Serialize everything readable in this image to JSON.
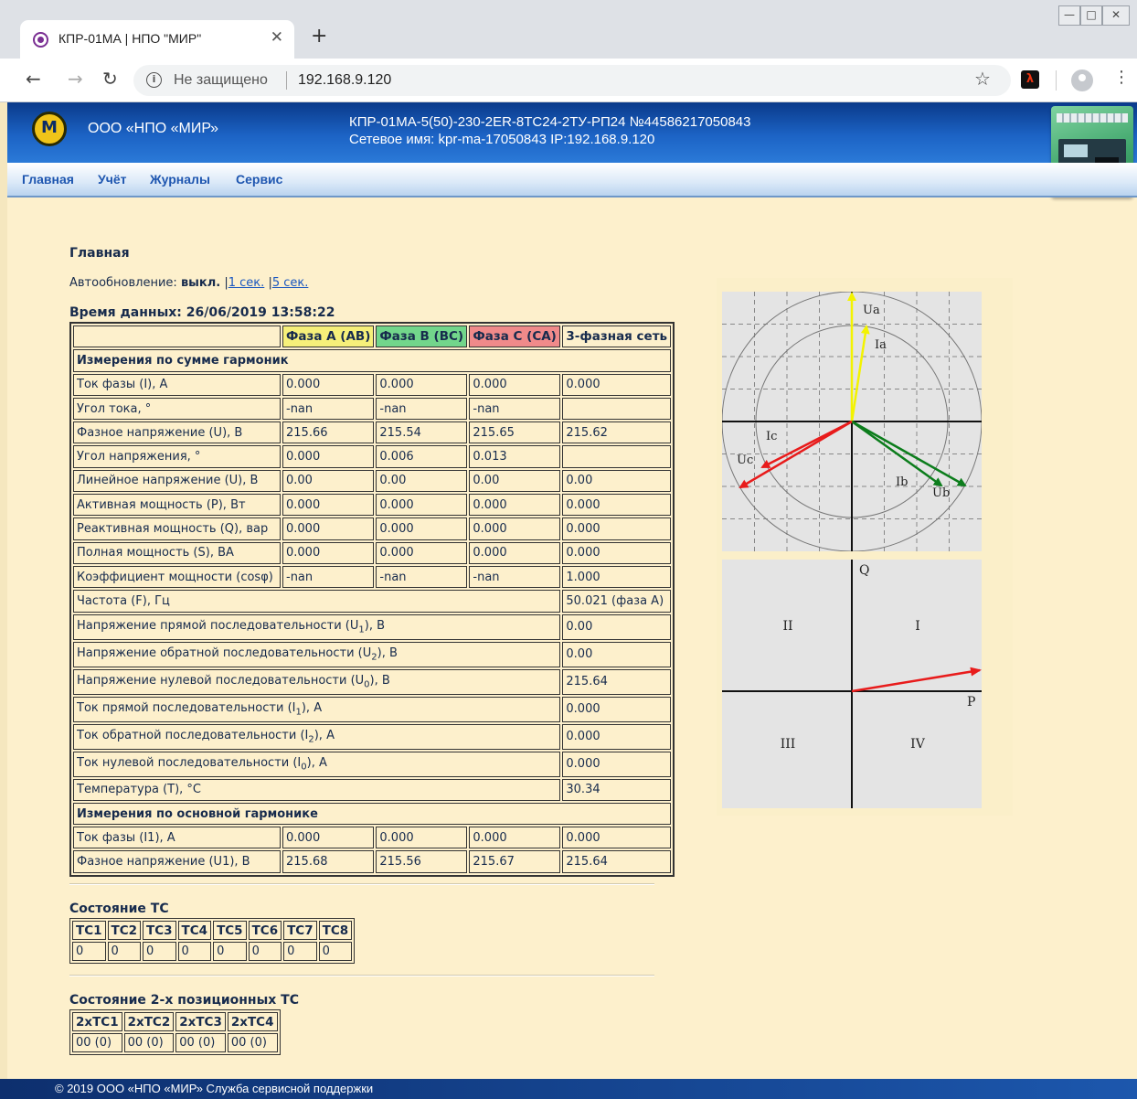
{
  "browser": {
    "tab_title": "КПР-01МА | НПО \"МИР\"",
    "tab_close": "✕",
    "new_tab": "+",
    "security_text": "Не защищено",
    "url": "192.168.9.120",
    "icons": [
      "back-arrow-icon",
      "forward-arrow-icon",
      "reload-icon",
      "info-icon",
      "star-icon",
      "pdf-icon",
      "avatar-icon",
      "menu-kebab-icon",
      "minimize-icon",
      "maximize-icon",
      "close-icon"
    ]
  },
  "header": {
    "org_name": "ООО «НПО «МИР»",
    "device_title": "КПР-01МА-5(50)-230-2ER-8ТС24-2ТУ-РП24 №44586217050843",
    "network_line": "Сетевое имя: kpr-ma-17050843 IP:192.168.9.120",
    "accent_color": "#1c63c5"
  },
  "nav": {
    "items": [
      "Главная",
      "Учёт",
      "Журналы",
      "Сервис"
    ]
  },
  "main": {
    "title": "Главная",
    "autorefresh_label": "Автообновление:",
    "autorefresh_state": "выкл.",
    "autorefresh_sep": "|",
    "autorefresh_opts": [
      "1 сек.",
      "5 сек."
    ],
    "data_time": "Время данных: 26/06/2019 13:58:22"
  },
  "table": {
    "headers": [
      "",
      "Фаза А (AB)",
      "Фаза В (BC)",
      "Фаза С (CA)",
      "3-фазная сеть"
    ],
    "section_sum": "Измерения по сумме гармоник",
    "rows4": [
      {
        "label": "Ток фазы (I), А",
        "a": "0.000",
        "b": "0.000",
        "c": "0.000",
        "t": "0.000"
      },
      {
        "label": "Угол тока, °",
        "a": "-nan",
        "b": "-nan",
        "c": "-nan",
        "t": ""
      },
      {
        "label": "Фазное напряжение (U), В",
        "a": "215.66",
        "b": "215.54",
        "c": "215.65",
        "t": "215.62"
      },
      {
        "label": "Угол напряжения, °",
        "a": "0.000",
        "b": "0.006",
        "c": "0.013",
        "t": ""
      },
      {
        "label": "Линейное напряжение (U), В",
        "a": "0.00",
        "b": "0.00",
        "c": "0.00",
        "t": "0.00"
      },
      {
        "label": "Активная мощность (P), Вт",
        "a": "0.000",
        "b": "0.000",
        "c": "0.000",
        "t": "0.000"
      },
      {
        "label": "Реактивная мощность (Q), вар",
        "a": "0.000",
        "b": "0.000",
        "c": "0.000",
        "t": "0.000"
      },
      {
        "label": "Полная мощность (S), ВА",
        "a": "0.000",
        "b": "0.000",
        "c": "0.000",
        "t": "0.000"
      },
      {
        "label": "Коэффициент мощности (cosφ)",
        "a": "-nan",
        "b": "-nan",
        "c": "-nan",
        "t": "1.000"
      }
    ],
    "freq": {
      "label": "Частота (F), Гц",
      "t": "50.021 (фаза А)"
    },
    "seq": [
      {
        "label": "Напряжение прямой последовательности (U",
        "sub": "1",
        "tail": "), В",
        "t": "0.00"
      },
      {
        "label": "Напряжение обратной последовательности (U",
        "sub": "2",
        "tail": "), В",
        "t": "0.00"
      },
      {
        "label": "Напряжение нулевой последовательности (U",
        "sub": "0",
        "tail": "), В",
        "t": "215.64"
      },
      {
        "label": "Ток прямой последовательности (I",
        "sub": "1",
        "tail": "), А",
        "t": "0.000"
      },
      {
        "label": "Ток обратной последовательности (I",
        "sub": "2",
        "tail": "), А",
        "t": "0.000"
      },
      {
        "label": "Ток нулевой последовательности (I",
        "sub": "0",
        "tail": "), А",
        "t": "0.000"
      }
    ],
    "temp": {
      "label": "Температура (T), °C",
      "t": "30.34"
    },
    "section_fund": "Измерения по основной гармонике",
    "fund": [
      {
        "label": "Ток фазы (I1), А",
        "a": "0.000",
        "b": "0.000",
        "c": "0.000",
        "t": "0.000"
      },
      {
        "label": "Фазное напряжение (U1), В",
        "a": "215.68",
        "b": "215.56",
        "c": "215.67",
        "t": "215.64"
      }
    ]
  },
  "tc": {
    "title": "Состояние ТС",
    "headers": [
      "ТС1",
      "ТС2",
      "ТС3",
      "ТС4",
      "ТС5",
      "ТС6",
      "ТС7",
      "ТС8"
    ],
    "values": [
      "0",
      "0",
      "0",
      "0",
      "0",
      "0",
      "0",
      "0"
    ]
  },
  "tc2": {
    "title": "Состояние 2-х позиционных ТС",
    "headers": [
      "2хТС1",
      "2хТС2",
      "2хТС3",
      "2хТС4"
    ],
    "values": [
      "00 (0)",
      "00 (0)",
      "00 (0)",
      "00 (0)"
    ]
  },
  "vector_diagram": {
    "labels": {
      "ua": "Ua",
      "ia": "Ia",
      "ub": "Ub",
      "ib": "Ib",
      "uc": "Uc",
      "ic": "Ic"
    },
    "colors": {
      "a": "#f3f300",
      "b": "#0c7d1c",
      "c": "#e81b1b"
    }
  },
  "power_diagram": {
    "axis_q": "Q",
    "axis_p": "P",
    "quadrants": [
      "I",
      "II",
      "III",
      "IV"
    ]
  },
  "footer": {
    "text": "© 2019 ООО «НПО «МИР» Служба сервисной поддержки"
  }
}
